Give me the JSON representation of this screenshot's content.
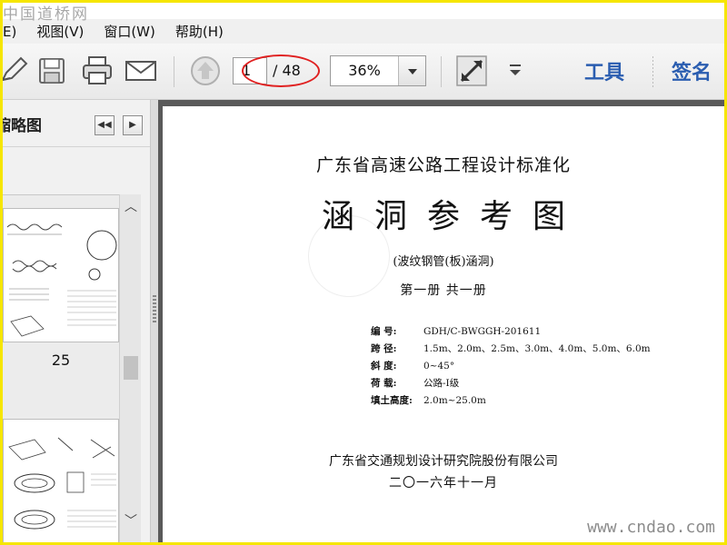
{
  "watermark": {
    "top": "中国道桥网",
    "bottom": "www.cndao.com"
  },
  "menu": [
    {
      "label": "E)"
    },
    {
      "label": "视图(V)"
    },
    {
      "label": "窗口(W)"
    },
    {
      "label": "帮助(H)"
    }
  ],
  "toolbar": {
    "icons": [
      "edit-icon",
      "save-icon",
      "print-icon",
      "email-icon",
      "page-up-icon",
      "fullscreen-icon",
      "more-icon"
    ],
    "page_current": "1",
    "page_total": "/ 48",
    "zoom": "36%",
    "tools_label": "工具",
    "sign_label": "签名",
    "accent": "#2a5db0",
    "highlight_color": "#e02020"
  },
  "sidebar": {
    "title": "缩略图",
    "prev_glyph": "◀◀",
    "next_glyph": "▶",
    "thumb_label": "25"
  },
  "document": {
    "line1": "广东省高速公路工程设计标准化",
    "title": "涵洞参考图",
    "subtitle": "(波纹钢管(板)涵洞)",
    "volume": "第一册   共一册",
    "specs": [
      {
        "key": "编    号:",
        "value": "GDH/C-BWGGH-201611"
      },
      {
        "key": "跨    径:",
        "value": "1.5m、2.0m、2.5m、3.0m、4.0m、5.0m、6.0m"
      },
      {
        "key": "斜    度:",
        "value": "0~45°"
      },
      {
        "key": "荷    载:",
        "value": "公路-I级"
      },
      {
        "key": "填土高度:",
        "value": "2.0m~25.0m"
      }
    ],
    "org": "广东省交通规划设计研究院股份有限公司",
    "date": "二〇一六年十一月"
  }
}
